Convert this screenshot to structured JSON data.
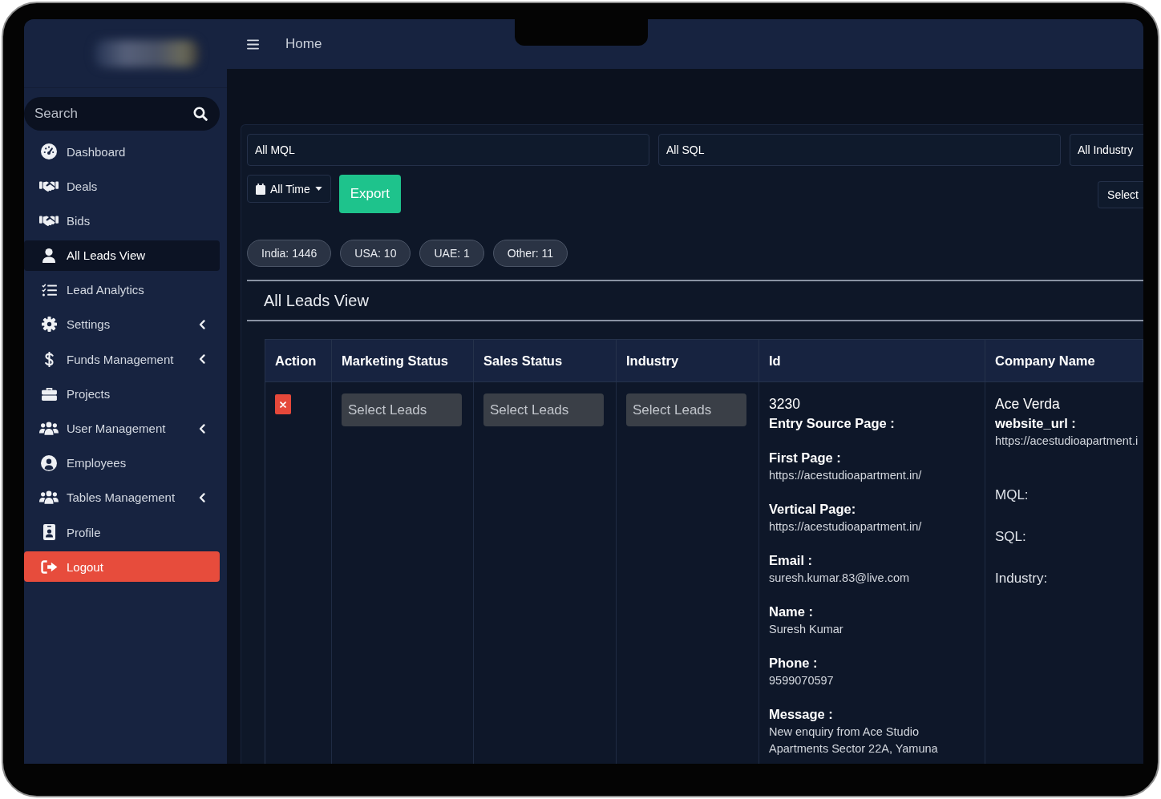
{
  "topbar": {
    "breadcrumb": "Home"
  },
  "sidebar": {
    "search": {
      "placeholder": "Search"
    },
    "items": [
      {
        "label": "Dashboard",
        "kind": "link",
        "selected": false,
        "expandable": false
      },
      {
        "label": "Deals",
        "kind": "link",
        "selected": false,
        "expandable": false
      },
      {
        "label": "Bids",
        "kind": "link",
        "selected": false,
        "expandable": false
      },
      {
        "label": "All Leads View",
        "kind": "link",
        "selected": true,
        "expandable": false
      },
      {
        "label": "Lead Analytics",
        "kind": "link",
        "selected": false,
        "expandable": false
      },
      {
        "label": "Settings",
        "kind": "link",
        "selected": false,
        "expandable": true
      },
      {
        "label": "Funds Management",
        "kind": "link",
        "selected": false,
        "expandable": true
      },
      {
        "label": "Projects",
        "kind": "link",
        "selected": false,
        "expandable": false
      },
      {
        "label": "User Management",
        "kind": "link",
        "selected": false,
        "expandable": true
      },
      {
        "label": "Employees",
        "kind": "link",
        "selected": false,
        "expandable": false
      },
      {
        "label": "Tables Management",
        "kind": "link",
        "selected": false,
        "expandable": true
      },
      {
        "label": "Profile",
        "kind": "link",
        "selected": false,
        "expandable": false
      },
      {
        "label": "Logout",
        "kind": "logout",
        "selected": false,
        "expandable": false
      }
    ]
  },
  "filters": {
    "selects": [
      {
        "value": "All MQL"
      },
      {
        "value": "All SQL"
      },
      {
        "value": "All Industry"
      }
    ],
    "date_range": {
      "value": "All Time"
    },
    "export_button": {
      "label": "Export"
    },
    "select_button": {
      "label": "Select"
    }
  },
  "country_counts": [
    {
      "label": "India: 1446"
    },
    {
      "label": "USA: 10"
    },
    {
      "label": "UAE: 1"
    },
    {
      "label": "Other: 11"
    }
  ],
  "section_title": "All Leads View",
  "table": {
    "columns": [
      "Action",
      "Marketing Status",
      "Sales Status",
      "Industry",
      "Id",
      "Company Name"
    ],
    "rows": [
      {
        "statuses": [
          {
            "placeholder": "Select Leads"
          },
          {
            "placeholder": "Select Leads"
          },
          {
            "placeholder": "Select Leads"
          }
        ],
        "id": "3230",
        "details": [
          {
            "label": "Entry Source Page :"
          },
          {
            "label": "First Page :",
            "value": "https://acestudioapartment.in/"
          },
          {
            "label": "Vertical Page:",
            "value": "https://acestudioapartment.in/"
          },
          {
            "label": "Email :",
            "value": "suresh.kumar.83@live.com"
          },
          {
            "label": "Name :",
            "value": "Suresh Kumar"
          },
          {
            "label": "Phone :",
            "value": "9599070597"
          },
          {
            "label": "Message :",
            "value": "New enquiry from Ace Studio Apartments Sector 22A, Yamuna"
          }
        ],
        "company": {
          "name": "Ace Verda",
          "website_label": "website_url :",
          "website": "https://acestudioapartment.i",
          "fields": [
            "MQL:",
            "SQL:",
            "Industry:"
          ]
        }
      }
    ]
  }
}
